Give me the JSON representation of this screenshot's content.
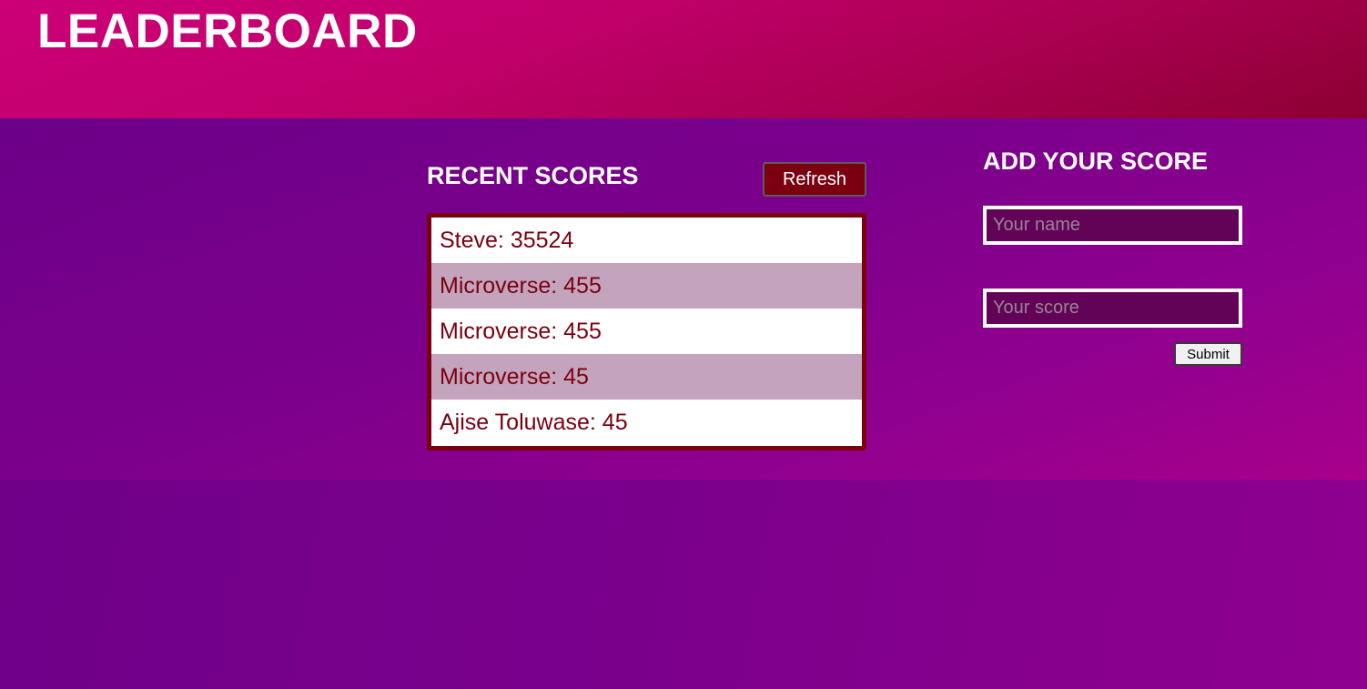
{
  "header": {
    "title": "LEADERBOARD"
  },
  "recent": {
    "title": "RECENT SCORES",
    "refresh_label": "Refresh",
    "scores": [
      "Steve: 35524",
      "Microverse: 455",
      "Microverse: 455",
      "Microverse: 45",
      "Ajise Toluwase: 45"
    ]
  },
  "add_score": {
    "title": "ADD YOUR SCORE",
    "name_placeholder": "Your name",
    "name_value": "",
    "score_placeholder": "Your score",
    "score_value": "",
    "submit_label": "Submit"
  },
  "colors": {
    "header_pink": "#c2006c",
    "main_purple": "#7a008c",
    "accent_maroon": "#7a0010",
    "row_alt": "#c4a4bc",
    "input_bg": "#620358"
  }
}
